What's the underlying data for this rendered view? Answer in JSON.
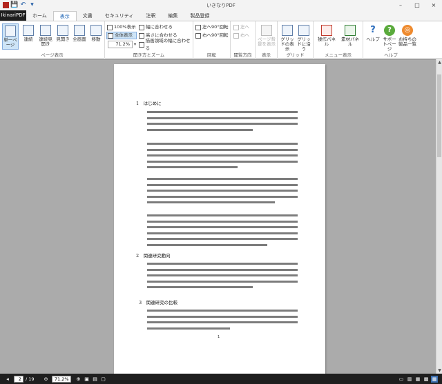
{
  "window": {
    "title": "いきなりPDF",
    "minimize": "–",
    "maximize": "□",
    "close": "×"
  },
  "quick_access": [
    {
      "icon": "save-icon",
      "glyph": "💾"
    },
    {
      "icon": "undo-icon",
      "glyph": "↶"
    },
    {
      "icon": "dropdown-icon",
      "glyph": "▾"
    }
  ],
  "file_tab": "IkinariPDF",
  "tabs": [
    "ホーム",
    "表示",
    "文書",
    "セキュリティ",
    "注釈",
    "編集",
    "製品登録"
  ],
  "active_tab": "表示",
  "ribbon": {
    "page_view": {
      "label": "ページ表示",
      "buttons": [
        "単一ページ",
        "連続",
        "連続見開き",
        "見開き",
        "全画面",
        "移動"
      ]
    },
    "zoom": {
      "label": "開き方とズーム",
      "small": [
        "100%表示",
        "全体表示",
        "幅に合わせる",
        "高さに合わせる",
        "描画領域の幅に合わせる"
      ],
      "zoom_value": "71.2%"
    },
    "rotate": {
      "label": "回転",
      "items": [
        "左へ90°回転",
        "右へ90°回転"
      ]
    },
    "reading": {
      "label": "閲覧方向",
      "items": [
        "左へ",
        "右へ"
      ]
    },
    "display": {
      "label": "表示",
      "button": "ページ背景を表示"
    },
    "grid": {
      "label": "グリッド",
      "buttons": [
        "グリッドの表示",
        "グリッドに沿う"
      ]
    },
    "menu_view": {
      "label": "メニュー表示",
      "buttons": [
        "操作パネル",
        "素材パネル"
      ]
    },
    "help": {
      "label": "ヘルプ",
      "buttons": [
        "ヘルプ",
        "サポートページ",
        "お持ちの製品一覧"
      ]
    }
  },
  "document": {
    "heading1": "1　はじめに",
    "heading2": "2　関連研究動向",
    "heading3": "3　関連研究の比較",
    "page_number": "1"
  },
  "status": {
    "page_current": "2",
    "page_total": "/ 19",
    "zoom": "71.2%"
  }
}
